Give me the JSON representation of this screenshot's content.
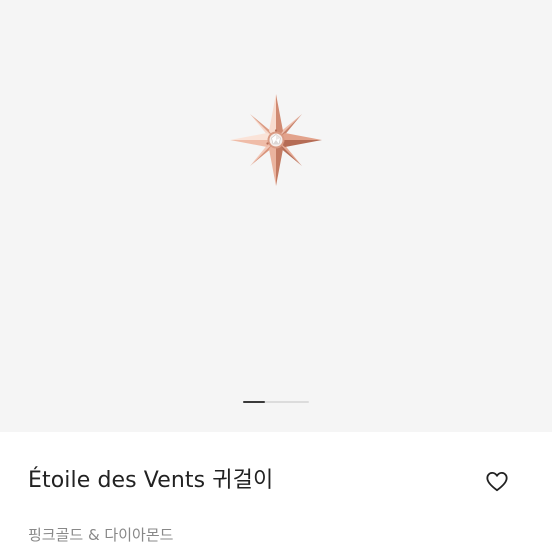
{
  "product": {
    "title": "Étoile des Vents 귀걸이",
    "subtitle": "핑크골드 & 다이아몬드"
  },
  "carousel": {
    "current_slide": 1,
    "total_slides": 3
  },
  "icons": {
    "wishlist": "heart-outline-icon",
    "image": "star-earring-image"
  },
  "colors": {
    "hero_background": "#f5f5f5",
    "metal_light": "#f6d3c6",
    "metal_mid": "#e6a78f",
    "metal_dark": "#c47c64",
    "text_primary": "#222222",
    "text_secondary": "#888888"
  }
}
